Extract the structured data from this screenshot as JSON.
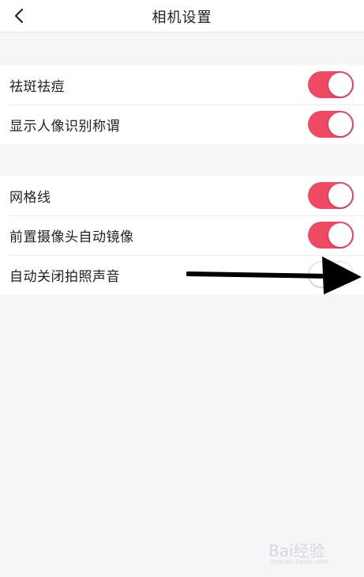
{
  "header": {
    "title": "相机设置",
    "back_icon": "chevron-left-icon"
  },
  "groups": [
    {
      "items": [
        {
          "label": "祛斑祛痘",
          "toggle": "on"
        },
        {
          "label": "显示人像识别称谓",
          "toggle": "on"
        }
      ]
    },
    {
      "items": [
        {
          "label": "网格线",
          "toggle": "on"
        },
        {
          "label": "前置摄像头自动镜像",
          "toggle": "on"
        },
        {
          "label": "自动关闭拍照声音",
          "toggle": "off"
        }
      ]
    }
  ],
  "colors": {
    "toggle_on": "#ee4a63",
    "background": "#f6f6f8",
    "annotation_arrow": "#000000"
  },
  "watermark": {
    "text": "Bai经验",
    "sub": "jingyan.baidu.com"
  }
}
